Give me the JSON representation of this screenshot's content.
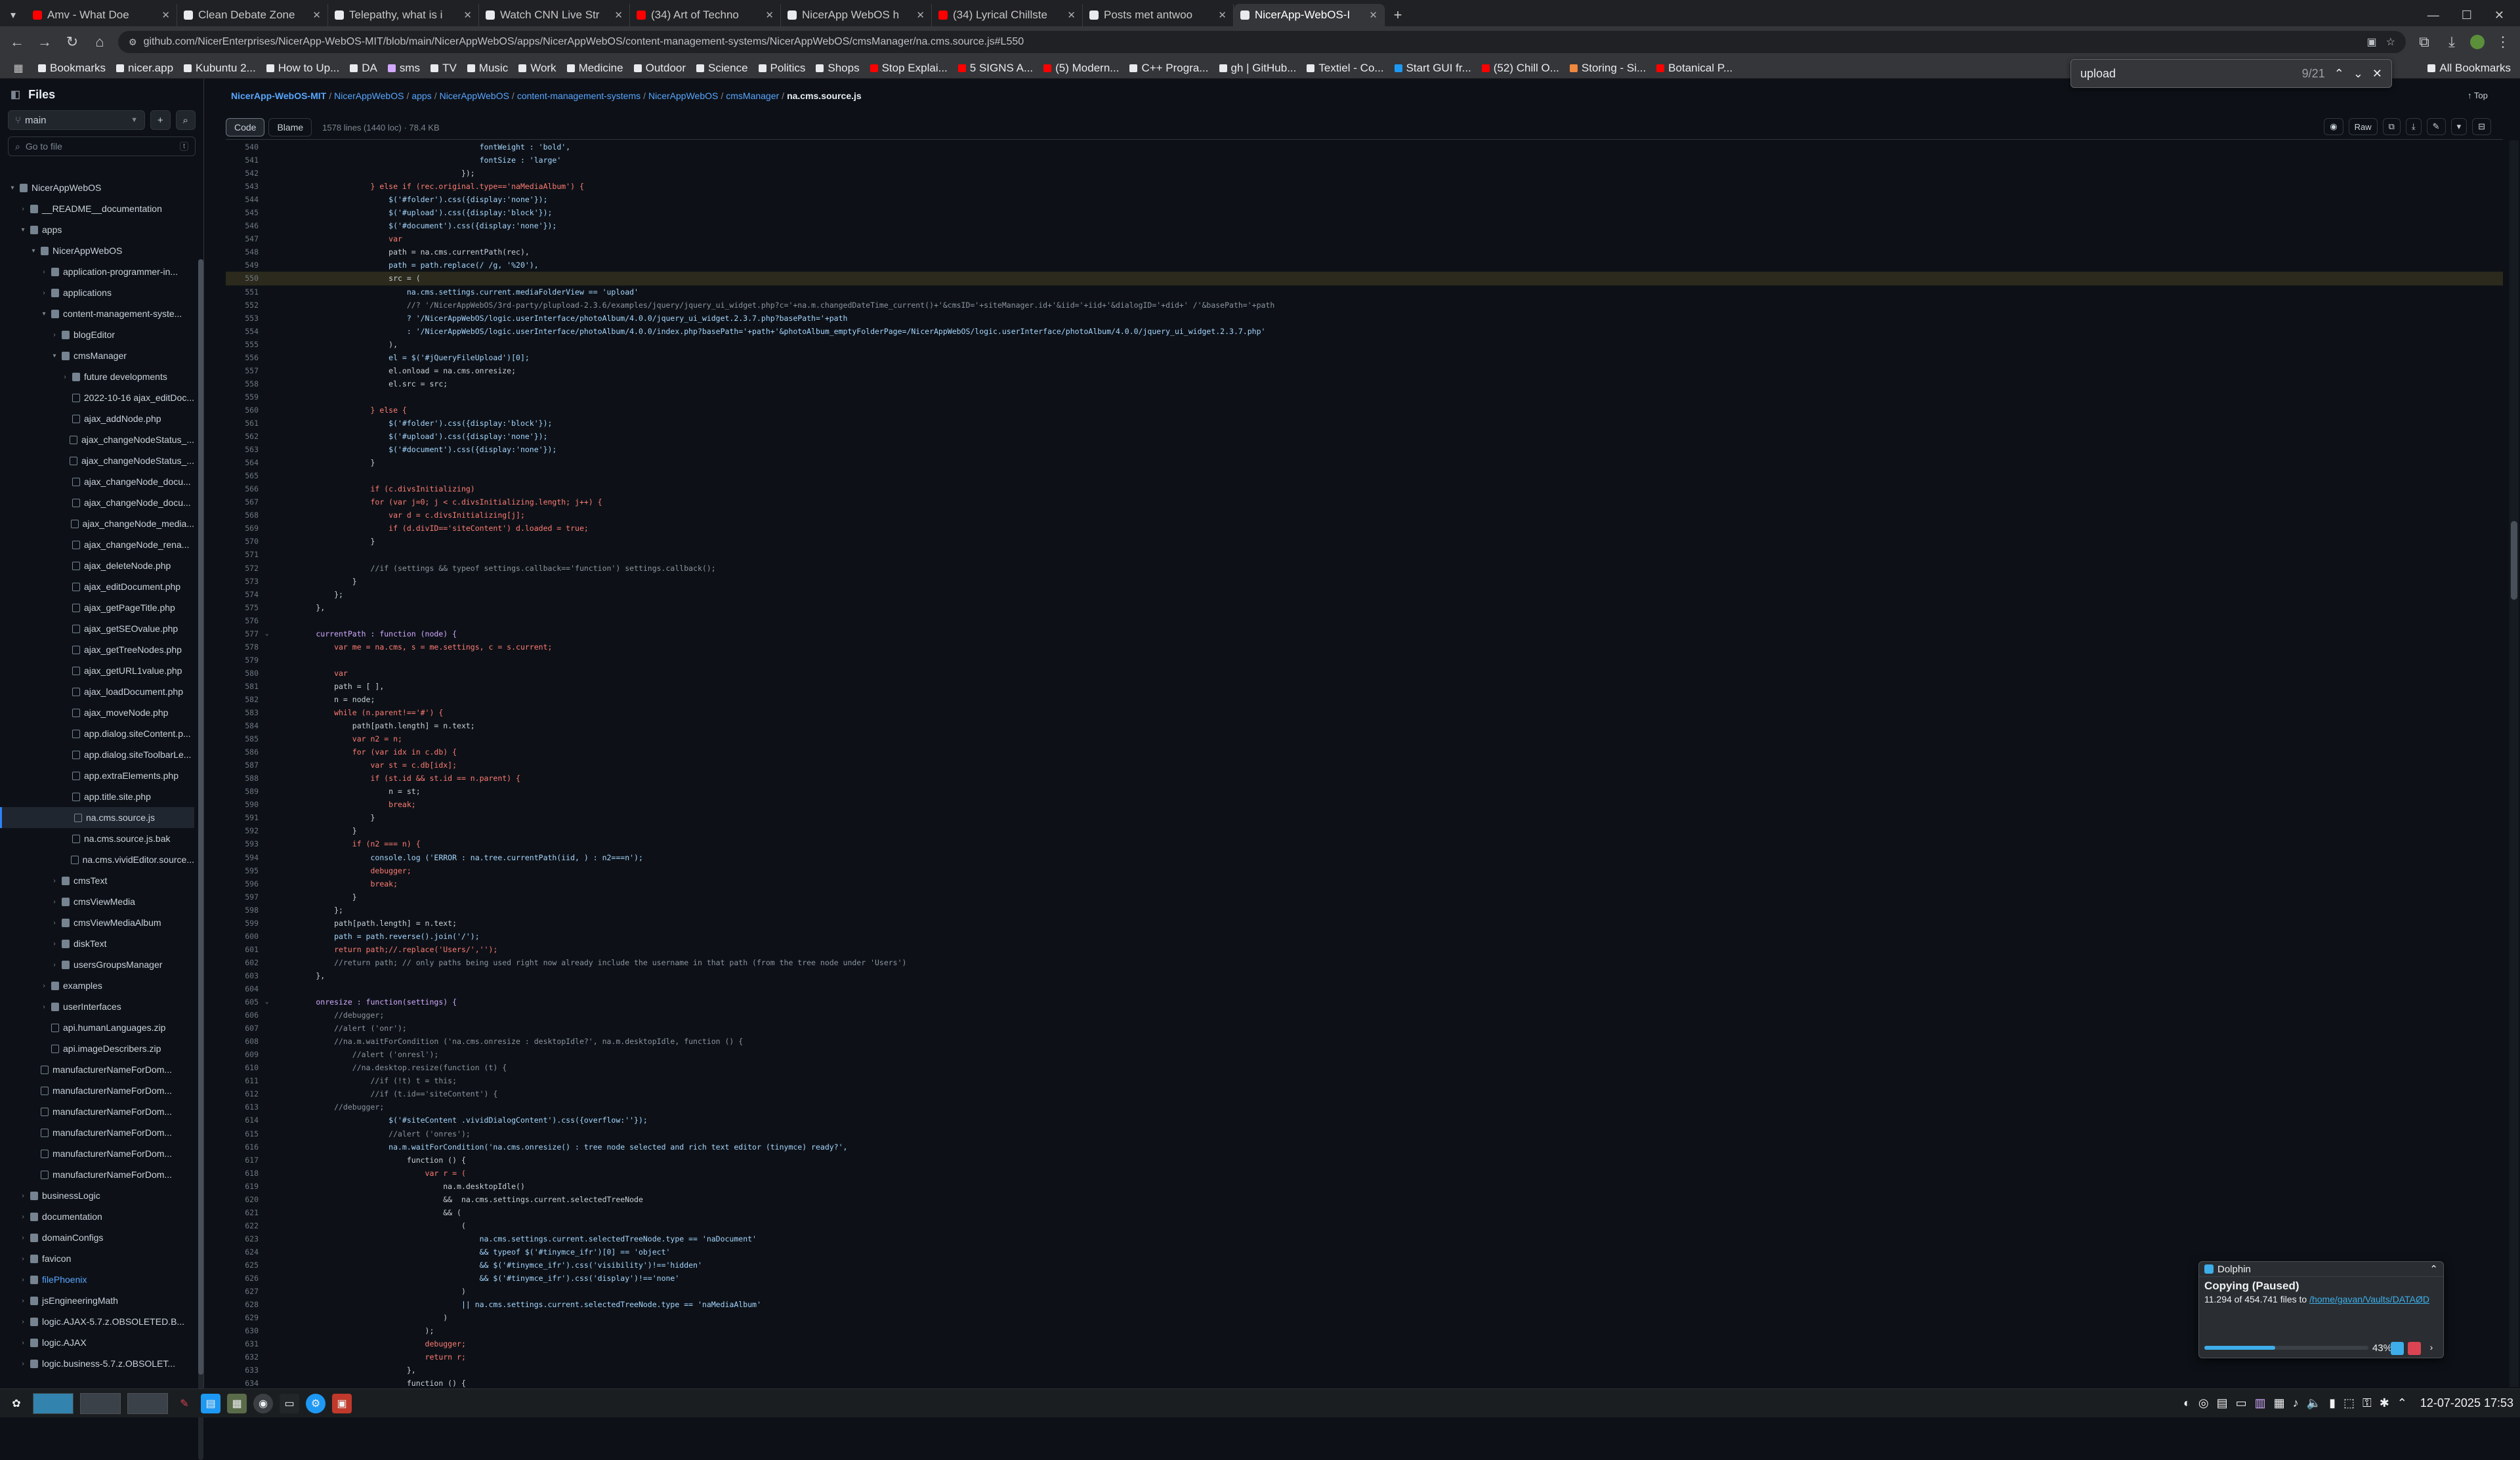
{
  "browser": {
    "tabs": [
      {
        "label": "Amv - What Doe",
        "fav": "#ff0000"
      },
      {
        "label": "Clean Debate Zone",
        "fav": "#e8eaed"
      },
      {
        "label": "Telepathy, what is i",
        "fav": "#e8eaed"
      },
      {
        "label": "Watch CNN Live Str",
        "fav": "#e8eaed"
      },
      {
        "label": "(34) Art of Techno",
        "fav": "#ff0000"
      },
      {
        "label": "NicerApp WebOS h",
        "fav": "#e8eaed"
      },
      {
        "label": "(34) Lyrical Chillste",
        "fav": "#ff0000"
      },
      {
        "label": "Posts met antwoo",
        "fav": "#e8eaed"
      },
      {
        "label": "NicerApp-WebOS-I",
        "fav": "#e8eaed"
      }
    ],
    "url": "github.com/NicerEnterprises/NicerApp-WebOS-MIT/blob/main/NicerAppWebOS/apps/NicerAppWebOS/content-management-systems/NicerAppWebOS/cmsManager/na.cms.source.js#L550",
    "bookmarks": [
      "Bookmarks",
      "nicer.app",
      "Kubuntu 2...",
      "How to Up...",
      "DA",
      "sms",
      "TV",
      "Music",
      "Work",
      "Medicine",
      "Outdoor",
      "Science",
      "Politics",
      "Shops",
      "Stop Explai...",
      "5 SIGNS A...",
      "(5) Modern...",
      "C++ Progra...",
      "gh | GitHub...",
      "Textiel - Co...",
      "Start GUI fr...",
      "(52) Chill O...",
      "Storing - Si...",
      "Botanical P...",
      "All Bookmarks"
    ],
    "find": {
      "query": "upload",
      "count": "9/21"
    }
  },
  "sidebar": {
    "title": "Files",
    "branch": "main",
    "goto_placeholder": "Go to file",
    "goto_shortcut": "t",
    "tree": [
      {
        "d": 0,
        "t": "folder",
        "open": true,
        "name": "NicerAppWebOS"
      },
      {
        "d": 1,
        "t": "folder",
        "open": false,
        "name": "__README__documentation"
      },
      {
        "d": 1,
        "t": "folder",
        "open": true,
        "name": "apps"
      },
      {
        "d": 2,
        "t": "folder",
        "open": true,
        "name": "NicerAppWebOS"
      },
      {
        "d": 3,
        "t": "folder",
        "open": false,
        "name": "application-programmer-in..."
      },
      {
        "d": 3,
        "t": "folder",
        "open": false,
        "name": "applications"
      },
      {
        "d": 3,
        "t": "folder",
        "open": true,
        "name": "content-management-syste..."
      },
      {
        "d": 4,
        "t": "folder",
        "open": false,
        "name": "blogEditor"
      },
      {
        "d": 4,
        "t": "folder",
        "open": true,
        "name": "cmsManager"
      },
      {
        "d": 5,
        "t": "folder",
        "open": false,
        "name": "future developments"
      },
      {
        "d": 5,
        "t": "file",
        "name": "2022-10-16 ajax_editDoc..."
      },
      {
        "d": 5,
        "t": "file",
        "name": "ajax_addNode.php"
      },
      {
        "d": 5,
        "t": "file",
        "name": "ajax_changeNodeStatus_..."
      },
      {
        "d": 5,
        "t": "file",
        "name": "ajax_changeNodeStatus_..."
      },
      {
        "d": 5,
        "t": "file",
        "name": "ajax_changeNode_docu..."
      },
      {
        "d": 5,
        "t": "file",
        "name": "ajax_changeNode_docu..."
      },
      {
        "d": 5,
        "t": "file",
        "name": "ajax_changeNode_media..."
      },
      {
        "d": 5,
        "t": "file",
        "name": "ajax_changeNode_rena..."
      },
      {
        "d": 5,
        "t": "file",
        "name": "ajax_deleteNode.php"
      },
      {
        "d": 5,
        "t": "file",
        "name": "ajax_editDocument.php"
      },
      {
        "d": 5,
        "t": "file",
        "name": "ajax_getPageTitle.php"
      },
      {
        "d": 5,
        "t": "file",
        "name": "ajax_getSEOvalue.php"
      },
      {
        "d": 5,
        "t": "file",
        "name": "ajax_getTreeNodes.php"
      },
      {
        "d": 5,
        "t": "file",
        "name": "ajax_getURL1value.php"
      },
      {
        "d": 5,
        "t": "file",
        "name": "ajax_loadDocument.php"
      },
      {
        "d": 5,
        "t": "file",
        "name": "ajax_moveNode.php"
      },
      {
        "d": 5,
        "t": "file",
        "name": "app.dialog.siteContent.p..."
      },
      {
        "d": 5,
        "t": "file",
        "name": "app.dialog.siteToolbarLe..."
      },
      {
        "d": 5,
        "t": "file",
        "name": "app.extraElements.php"
      },
      {
        "d": 5,
        "t": "file",
        "name": "app.title.site.php"
      },
      {
        "d": 5,
        "t": "file",
        "name": "na.cms.source.js",
        "sel": true
      },
      {
        "d": 5,
        "t": "file",
        "name": "na.cms.source.js.bak"
      },
      {
        "d": 5,
        "t": "file",
        "name": "na.cms.vividEditor.source..."
      },
      {
        "d": 4,
        "t": "folder",
        "open": false,
        "name": "cmsText"
      },
      {
        "d": 4,
        "t": "folder",
        "open": false,
        "name": "cmsViewMedia"
      },
      {
        "d": 4,
        "t": "folder",
        "open": false,
        "name": "cmsViewMediaAlbum"
      },
      {
        "d": 4,
        "t": "folder",
        "open": false,
        "name": "diskText"
      },
      {
        "d": 4,
        "t": "folder",
        "open": false,
        "name": "usersGroupsManager"
      },
      {
        "d": 3,
        "t": "folder",
        "open": false,
        "name": "examples"
      },
      {
        "d": 3,
        "t": "folder",
        "open": false,
        "name": "userInterfaces"
      },
      {
        "d": 3,
        "t": "file",
        "name": "api.humanLanguages.zip"
      },
      {
        "d": 3,
        "t": "file",
        "name": "api.imageDescribers.zip"
      },
      {
        "d": 2,
        "t": "file",
        "name": "manufacturerNameForDom..."
      },
      {
        "d": 2,
        "t": "file",
        "name": "manufacturerNameForDom..."
      },
      {
        "d": 2,
        "t": "file",
        "name": "manufacturerNameForDom..."
      },
      {
        "d": 2,
        "t": "file",
        "name": "manufacturerNameForDom..."
      },
      {
        "d": 2,
        "t": "file",
        "name": "manufacturerNameForDom..."
      },
      {
        "d": 2,
        "t": "file",
        "name": "manufacturerNameForDom..."
      },
      {
        "d": 1,
        "t": "folder",
        "open": false,
        "name": "businessLogic"
      },
      {
        "d": 1,
        "t": "folder",
        "open": false,
        "name": "documentation"
      },
      {
        "d": 1,
        "t": "folder",
        "open": false,
        "name": "domainConfigs"
      },
      {
        "d": 1,
        "t": "folder",
        "open": false,
        "name": "favicon"
      },
      {
        "d": 1,
        "t": "folder",
        "open": false,
        "name": "filePhoenix",
        "link": true
      },
      {
        "d": 1,
        "t": "folder",
        "open": false,
        "name": "jsEngineeringMath"
      },
      {
        "d": 1,
        "t": "folder",
        "open": false,
        "name": "logic.AJAX-5.7.z.OBSOLETED.B..."
      },
      {
        "d": 1,
        "t": "folder",
        "open": false,
        "name": "logic.AJAX"
      },
      {
        "d": 1,
        "t": "folder",
        "open": false,
        "name": "logic.business-5.7.z.OBSOLET..."
      }
    ]
  },
  "main": {
    "breadcrumb": [
      "NicerApp-WebOS-MIT",
      "NicerAppWebOS",
      "apps",
      "NicerAppWebOS",
      "content-management-systems",
      "NicerAppWebOS",
      "cmsManager"
    ],
    "filename": "na.cms.source.js",
    "top_label": "Top",
    "tab_code": "Code",
    "tab_blame": "Blame",
    "file_info": "1578 lines (1440 loc) · 78.4 KB",
    "raw_label": "Raw",
    "code": [
      {
        "n": 540,
        "s": "                                            fontWeight : 'bold',"
      },
      {
        "n": 541,
        "s": "                                            fontSize : 'large'"
      },
      {
        "n": 542,
        "s": "                                        });"
      },
      {
        "n": 543,
        "s": "                    } else if (rec.original.type=='naMediaAlbum') {"
      },
      {
        "n": 544,
        "s": "                        $('#folder').css({display:'none'});"
      },
      {
        "n": 545,
        "s": "                        $('#upload').css({display:'block'});"
      },
      {
        "n": 546,
        "s": "                        $('#document').css({display:'none'});"
      },
      {
        "n": 547,
        "s": "                        var"
      },
      {
        "n": 548,
        "s": "                        path = na.cms.currentPath(rec),"
      },
      {
        "n": 549,
        "s": "                        path = path.replace(/ /g, '%20'),"
      },
      {
        "n": 550,
        "s": "                        src = (",
        "hl": true
      },
      {
        "n": 551,
        "s": "                            na.cms.settings.current.mediaFolderView == 'upload'"
      },
      {
        "n": 552,
        "s": "                            //? '/NicerAppWebOS/3rd-party/plupload-2.3.6/examples/jquery/jquery_ui_widget.php?c='+na.m.changedDateTime_current()+'&cmsID='+siteManager.id+'&iid='+iid+'&dialogID='+did+' /'&basePath='+path"
      },
      {
        "n": 553,
        "s": "                            ? '/NicerAppWebOS/logic.userInterface/photoAlbum/4.0.0/jquery_ui_widget.2.3.7.php?basePath='+path"
      },
      {
        "n": 554,
        "s": "                            : '/NicerAppWebOS/logic.userInterface/photoAlbum/4.0.0/index.php?basePath='+path+'&photoAlbum_emptyFolderPage=/NicerAppWebOS/logic.userInterface/photoAlbum/4.0.0/jquery_ui_widget.2.3.7.php'"
      },
      {
        "n": 555,
        "s": "                        ),"
      },
      {
        "n": 556,
        "s": "                        el = $('#jQueryFileUpload')[0];"
      },
      {
        "n": 557,
        "s": "                        el.onload = na.cms.onresize;"
      },
      {
        "n": 558,
        "s": "                        el.src = src;"
      },
      {
        "n": 559,
        "s": ""
      },
      {
        "n": 560,
        "s": "                    } else {"
      },
      {
        "n": 561,
        "s": "                        $('#folder').css({display:'block'});"
      },
      {
        "n": 562,
        "s": "                        $('#upload').css({display:'none'});"
      },
      {
        "n": 563,
        "s": "                        $('#document').css({display:'none'});"
      },
      {
        "n": 564,
        "s": "                    }"
      },
      {
        "n": 565,
        "s": ""
      },
      {
        "n": 566,
        "s": "                    if (c.divsInitializing)"
      },
      {
        "n": 567,
        "s": "                    for (var j=0; j < c.divsInitializing.length; j++) {"
      },
      {
        "n": 568,
        "s": "                        var d = c.divsInitializing[j];"
      },
      {
        "n": 569,
        "s": "                        if (d.divID=='siteContent') d.loaded = true;"
      },
      {
        "n": 570,
        "s": "                    }"
      },
      {
        "n": 571,
        "s": ""
      },
      {
        "n": 572,
        "s": "                    //if (settings && typeof settings.callback=='function') settings.callback();"
      },
      {
        "n": 573,
        "s": "                }"
      },
      {
        "n": 574,
        "s": "            };"
      },
      {
        "n": 575,
        "s": "        },"
      },
      {
        "n": 576,
        "s": ""
      },
      {
        "n": 577,
        "s": "        currentPath : function (node) {",
        "fold": true
      },
      {
        "n": 578,
        "s": "            var me = na.cms, s = me.settings, c = s.current;"
      },
      {
        "n": 579,
        "s": ""
      },
      {
        "n": 580,
        "s": "            var"
      },
      {
        "n": 581,
        "s": "            path = [ ],"
      },
      {
        "n": 582,
        "s": "            n = node;"
      },
      {
        "n": 583,
        "s": "            while (n.parent!=='#') {"
      },
      {
        "n": 584,
        "s": "                path[path.length] = n.text;"
      },
      {
        "n": 585,
        "s": "                var n2 = n;"
      },
      {
        "n": 586,
        "s": "                for (var idx in c.db) {"
      },
      {
        "n": 587,
        "s": "                    var st = c.db[idx];"
      },
      {
        "n": 588,
        "s": "                    if (st.id && st.id == n.parent) {"
      },
      {
        "n": 589,
        "s": "                        n = st;"
      },
      {
        "n": 590,
        "s": "                        break;"
      },
      {
        "n": 591,
        "s": "                    }"
      },
      {
        "n": 592,
        "s": "                }"
      },
      {
        "n": 593,
        "s": "                if (n2 === n) {"
      },
      {
        "n": 594,
        "s": "                    console.log ('ERROR : na.tree.currentPath(iid, ) : n2===n');"
      },
      {
        "n": 595,
        "s": "                    debugger;"
      },
      {
        "n": 596,
        "s": "                    break;"
      },
      {
        "n": 597,
        "s": "                }"
      },
      {
        "n": 598,
        "s": "            };"
      },
      {
        "n": 599,
        "s": "            path[path.length] = n.text;"
      },
      {
        "n": 600,
        "s": "            path = path.reverse().join('/');"
      },
      {
        "n": 601,
        "s": "            return path;//.replace('Users/','');"
      },
      {
        "n": 602,
        "s": "            //return path; // only paths being used right now already include the username in that path (from the tree node under 'Users')"
      },
      {
        "n": 603,
        "s": "        },"
      },
      {
        "n": 604,
        "s": ""
      },
      {
        "n": 605,
        "s": "        onresize : function(settings) {",
        "fold": true
      },
      {
        "n": 606,
        "s": "            //debugger;"
      },
      {
        "n": 607,
        "s": "            //alert ('onr');"
      },
      {
        "n": 608,
        "s": "            //na.m.waitForCondition ('na.cms.onresize : desktopIdle?', na.m.desktopIdle, function () {"
      },
      {
        "n": 609,
        "s": "                //alert ('onresl');"
      },
      {
        "n": 610,
        "s": "                //na.desktop.resize(function (t) {"
      },
      {
        "n": 611,
        "s": "                    //if (!t) t = this;"
      },
      {
        "n": 612,
        "s": "                    //if (t.id=='siteContent') {"
      },
      {
        "n": 613,
        "s": "            //debugger;"
      },
      {
        "n": 614,
        "s": "                        $('#siteContent .vividDialogContent').css({overflow:''});"
      },
      {
        "n": 615,
        "s": "                        //alert ('onres');"
      },
      {
        "n": 616,
        "s": "                        na.m.waitForCondition('na.cms.onresize() : tree node selected and rich text editor (tinymce) ready?',"
      },
      {
        "n": 617,
        "s": "                            function () {"
      },
      {
        "n": 618,
        "s": "                                var r = ("
      },
      {
        "n": 619,
        "s": "                                    na.m.desktopIdle()"
      },
      {
        "n": 620,
        "s": "                                    &&  na.cms.settings.current.selectedTreeNode"
      },
      {
        "n": 621,
        "s": "                                    && ("
      },
      {
        "n": 622,
        "s": "                                        ("
      },
      {
        "n": 623,
        "s": "                                            na.cms.settings.current.selectedTreeNode.type == 'naDocument'"
      },
      {
        "n": 624,
        "s": "                                            && typeof $('#tinymce_ifr')[0] == 'object'"
      },
      {
        "n": 625,
        "s": "                                            && $('#tinymce_ifr').css('visibility')!=='hidden'"
      },
      {
        "n": 626,
        "s": "                                            && $('#tinymce_ifr').css('display')!=='none'"
      },
      {
        "n": 627,
        "s": "                                        )"
      },
      {
        "n": 628,
        "s": "                                        || na.cms.settings.current.selectedTreeNode.type == 'naMediaAlbum'"
      },
      {
        "n": 629,
        "s": "                                    )"
      },
      {
        "n": 630,
        "s": "                                );"
      },
      {
        "n": 631,
        "s": "                                debugger;"
      },
      {
        "n": 632,
        "s": "                                return r;"
      },
      {
        "n": 633,
        "s": "                            },"
      },
      {
        "n": 634,
        "s": "                            function () {"
      }
    ]
  },
  "dolphin": {
    "app": "Dolphin",
    "title": "Copying (Paused)",
    "progress_text": "11.294 of 454.741 files to ",
    "dest": "/home/gavan/Vaults/DATAØD",
    "percent_label": "43%",
    "progress": 0.43
  },
  "taskbar": {
    "clock": "12-07-2025  17:53"
  },
  "colors": {
    "accent": "#2f81f7",
    "link": "#58a6ff",
    "kde_blue": "#3daee9"
  }
}
